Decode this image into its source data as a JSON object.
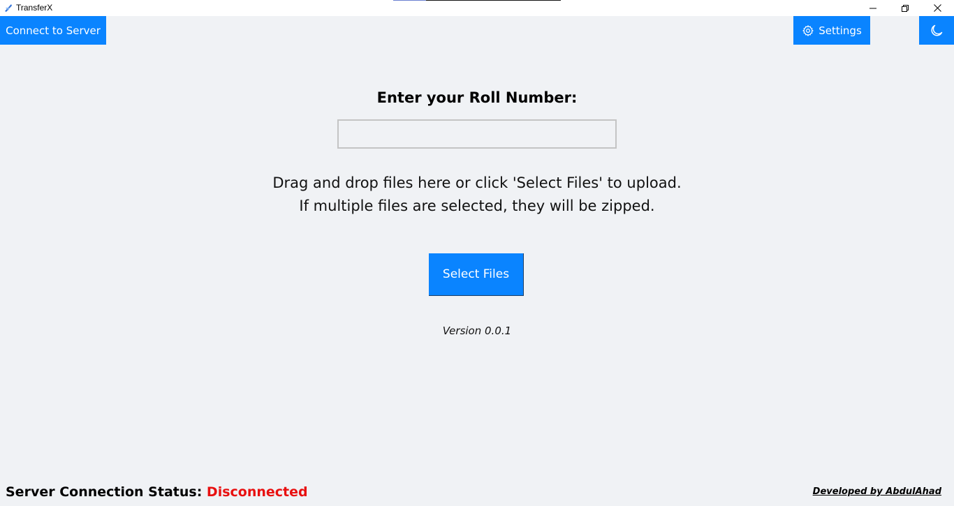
{
  "window": {
    "title": "TransferX",
    "minimize_icon": "minimize-icon",
    "maximize_icon": "restore-icon",
    "close_icon": "close-icon"
  },
  "toolbar": {
    "connect_label": "Connect to Server",
    "settings_label": "Settings",
    "settings_icon": "gear-icon",
    "theme_icon": "moon-icon"
  },
  "main": {
    "heading": "Enter your Roll Number:",
    "roll_input": {
      "value": "",
      "placeholder": ""
    },
    "instruction_line1": "Drag and drop files here or click 'Select Files' to upload.",
    "instruction_line2": "If multiple files are selected, they will be zipped.",
    "select_files_label": "Select Files",
    "version": "Version 0.0.1"
  },
  "footer": {
    "status_label": "Server Connection Status:",
    "status_value": "Disconnected",
    "developer": "Developed by AbdulAhad"
  },
  "colors": {
    "accent": "#0a84ff",
    "background": "#f0f2f5",
    "status_disconnected": "#e81010"
  }
}
